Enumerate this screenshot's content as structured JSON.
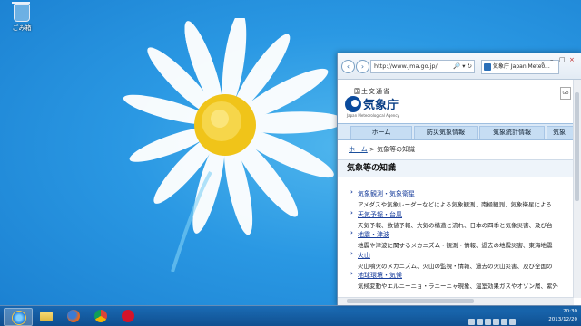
{
  "desktop": {
    "recycle_bin_label": "ごみ箱"
  },
  "browser": {
    "address_url": "http://www.jma.go.jp/",
    "address_controls": "🔎 ▾ ↻",
    "tab_title": "気象庁 Japan Meteo...",
    "tab_close": "×",
    "page": {
      "ministry": "国土交通省",
      "agency_name": "気象庁",
      "agency_english": "Japan Meteorological Agency",
      "search_button": "Go",
      "menu": [
        "ホーム",
        "防災気象情報",
        "気象統計情報",
        "気象"
      ],
      "breadcrumb_home": "ホーム",
      "breadcrumb_rest": " > 気象等の知識",
      "heading": "気象等の知識",
      "items": [
        {
          "title": "気象観測・気象衛星",
          "desc": "アメダスや気象レーダーなどによる気象観測、南極観測、気象衛星による"
        },
        {
          "title": "天気予報・台風",
          "desc": "天気予報、数値予報、大気の構造と流れ、日本の四季と気象災害、及び台"
        },
        {
          "title": "地震・津波",
          "desc": "地震や津波に関するメカニズム・観測・情報、過去の地震災害、東海地震"
        },
        {
          "title": "火山",
          "desc": "火山噴火のメカニズム、火山の監視・情報、過去の火山災害、及び全国の"
        },
        {
          "title": "地球環境・気候",
          "desc": "気候変動やエルニーニョ・ラニーニャ現象、温室効果ガスやオゾン層、紫外"
        }
      ]
    }
  },
  "taskbar": {
    "time": "20:30",
    "date": "2013/12/20"
  },
  "colors": {
    "desktop_blue": "#2a98e3",
    "jma_blue": "#0a3f86",
    "menu_bg": "#c6ddf3"
  }
}
